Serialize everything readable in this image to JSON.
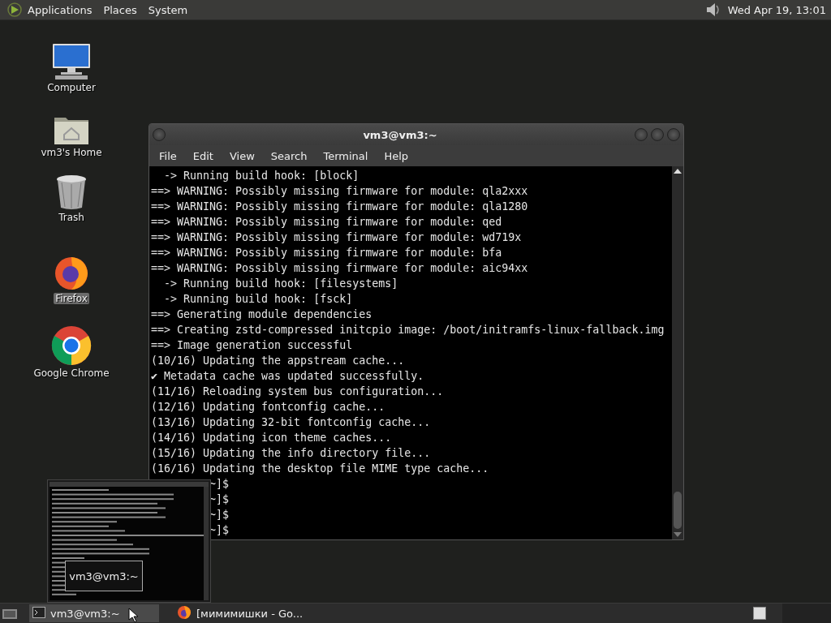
{
  "top_panel": {
    "menus": [
      "Applications",
      "Places",
      "System"
    ],
    "clock": "Wed Apr 19, 13:01"
  },
  "desktop_icons": [
    {
      "kind": "computer",
      "label": "Computer",
      "selected": false
    },
    {
      "kind": "home",
      "label": "vm3's Home",
      "selected": false
    },
    {
      "kind": "trash",
      "label": "Trash",
      "selected": false
    },
    {
      "kind": "firefox",
      "label": "Firefox",
      "selected": true
    },
    {
      "kind": "chrome",
      "label": "Google Chrome",
      "selected": false
    }
  ],
  "terminal": {
    "title": "vm3@vm3:~",
    "menu": [
      "File",
      "Edit",
      "View",
      "Search",
      "Terminal",
      "Help"
    ],
    "lines": [
      {
        "kind": "full",
        "text": "  -> Running build hook: [block]"
      },
      {
        "kind": "full",
        "text": "==> WARNING: Possibly missing firmware for module: qla2xxx"
      },
      {
        "kind": "full",
        "text": "==> WARNING: Possibly missing firmware for module: qla1280"
      },
      {
        "kind": "full",
        "text": "==> WARNING: Possibly missing firmware for module: qed"
      },
      {
        "kind": "full",
        "text": "==> WARNING: Possibly missing firmware for module: wd719x"
      },
      {
        "kind": "full",
        "text": "==> WARNING: Possibly missing firmware for module: bfa"
      },
      {
        "kind": "full",
        "text": "==> WARNING: Possibly missing firmware for module: aic94xx"
      },
      {
        "kind": "full",
        "text": "  -> Running build hook: [filesystems]"
      },
      {
        "kind": "full",
        "text": "  -> Running build hook: [fsck]"
      },
      {
        "kind": "full",
        "text": "==> Generating module dependencies"
      },
      {
        "kind": "full",
        "text": "==> Creating zstd-compressed initcpio image: /boot/initramfs-linux-fallback.img"
      },
      {
        "kind": "full",
        "text": "==> Image generation successful"
      },
      {
        "kind": "full",
        "text": "(10/16) Updating the appstream cache..."
      },
      {
        "kind": "full",
        "text": "✔ Metadata cache was updated successfully."
      },
      {
        "kind": "full",
        "text": "(11/16) Reloading system bus configuration..."
      },
      {
        "kind": "full",
        "text": "(12/16) Updating fontconfig cache..."
      },
      {
        "kind": "full",
        "text": "(13/16) Updating 32-bit fontconfig cache..."
      },
      {
        "kind": "full",
        "text": "(14/16) Updating icon theme caches..."
      },
      {
        "kind": "full",
        "text": "(15/16) Updating the info directory file..."
      },
      {
        "kind": "full",
        "text": "(16/16) Updating the desktop file MIME type cache..."
      },
      {
        "kind": "covered",
        "text": "~]$"
      },
      {
        "kind": "covered",
        "text": "~]$"
      },
      {
        "kind": "covered",
        "text": "~]$"
      },
      {
        "kind": "covered",
        "text": "~]$"
      }
    ]
  },
  "preview": {
    "tooltip": "vm3@vm3:~"
  },
  "taskbar": {
    "tasks": [
      {
        "kind": "terminal",
        "label": "vm3@vm3:~",
        "selected": true
      },
      {
        "kind": "firefox",
        "label": "[мимимишки - Go...",
        "selected": false
      }
    ]
  }
}
